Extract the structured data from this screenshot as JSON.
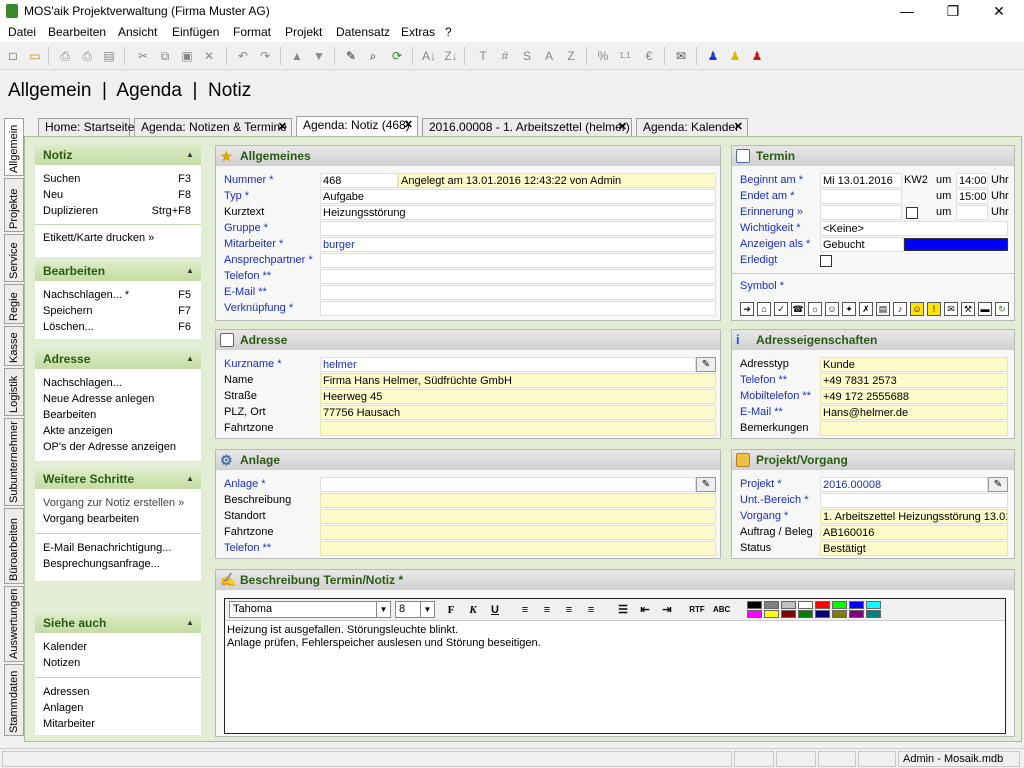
{
  "window": {
    "title": "MOS'aik Projektverwaltung (Firma Muster AG)",
    "min": "—",
    "max": "❐",
    "close": "✕"
  },
  "menu": [
    "Datei",
    "Bearbeiten",
    "Ansicht",
    "Einfügen",
    "Format",
    "Projekt",
    "Datensatz",
    "Extras",
    "?"
  ],
  "page_title": "Allgemein  |  Agenda  |  Notiz",
  "tabs": [
    {
      "label": "Home: Startseite",
      "closable": false
    },
    {
      "label": "Agenda: Notizen & Termine",
      "closable": true
    },
    {
      "label": "Agenda: Notiz (468)",
      "closable": true,
      "active": true
    },
    {
      "label": "2016.00008 - 1. Arbeitszettel (helmer)",
      "closable": true
    },
    {
      "label": "Agenda: Kalender",
      "closable": true
    }
  ],
  "vtabs": [
    "Allgemein",
    "Projekte",
    "Service",
    "Regie",
    "Kasse",
    "Logistik",
    "Subunternehmer",
    "Büroarbeiten",
    "Auswertungen",
    "Stammdaten"
  ],
  "sidebar": {
    "notiz": {
      "title": "Notiz",
      "items": [
        {
          "label": "Suchen",
          "key": "F3"
        },
        {
          "label": "Neu",
          "key": "F8"
        },
        {
          "label": "Duplizieren",
          "key": "Strg+F8"
        },
        {
          "label": "Etikett/Karte drucken »",
          "key": ""
        }
      ]
    },
    "bearbeiten": {
      "title": "Bearbeiten",
      "items": [
        {
          "label": "Nachschlagen... *",
          "key": "F5"
        },
        {
          "label": "Speichern",
          "key": "F7"
        },
        {
          "label": "Löschen...",
          "key": "F6"
        }
      ]
    },
    "adresse": {
      "title": "Adresse",
      "items": [
        {
          "label": "Nachschlagen..."
        },
        {
          "label": "Neue Adresse anlegen"
        },
        {
          "label": "Bearbeiten"
        },
        {
          "label": "Akte anzeigen"
        },
        {
          "label": "OP's der Adresse anzeigen"
        }
      ]
    },
    "weitere": {
      "title": "Weitere Schritte",
      "items": [
        {
          "label": "Vorgang zur Notiz erstellen »"
        },
        {
          "label": "Vorgang bearbeiten"
        },
        {
          "label": "E-Mail Benachrichtigung..."
        },
        {
          "label": "Besprechungsanfrage..."
        }
      ]
    },
    "siehe": {
      "title": "Siehe auch",
      "items": [
        {
          "label": "Kalender"
        },
        {
          "label": "Notizen"
        },
        {
          "label": "Adressen"
        },
        {
          "label": "Anlagen"
        },
        {
          "label": "Mitarbeiter"
        }
      ]
    }
  },
  "allgemeines": {
    "title": "Allgemeines",
    "labels": [
      "Nummer *",
      "Typ *",
      "Kurztext",
      "Gruppe *",
      "Mitarbeiter *",
      "Ansprechpartner *",
      "Telefon **",
      "E-Mail **",
      "Verknüpfung *"
    ],
    "nummer": "468",
    "angelegt": "Angelegt am 13.01.2016 12:43:22 von Admin",
    "typ": "Aufgabe",
    "kurztext": "Heizungsstörung",
    "mitarbeiter": "burger"
  },
  "termin": {
    "title": "Termin",
    "beginnt_label": "Beginnt am *",
    "beginnt_date": "Mi 13.01.2016",
    "kw": "KW2",
    "um1": "um",
    "time1": "14:00",
    "uhr1": "Uhr",
    "endet_label": "Endet am *",
    "um2": "um",
    "time2": "15:00",
    "uhr2": "Uhr",
    "erinnerung_label": "Erinnerung »",
    "um3": "um",
    "uhr3": "Uhr",
    "wichtigkeit_label": "Wichtigkeit *",
    "wichtigkeit": "<Keine>",
    "anzeigen_label": "Anzeigen als *",
    "anzeigen": "Gebucht",
    "anzeigen_color": "#0000ff",
    "erledigt_label": "Erledigt",
    "symbol_label": "Symbol *"
  },
  "adresse": {
    "title": "Adresse",
    "labels": [
      "Kurzname *",
      "Name",
      "Straße",
      "PLZ, Ort",
      "Fahrtzone"
    ],
    "kurzname": "helmer",
    "name": "Firma Hans Helmer, Südfrüchte GmbH",
    "strasse": "Heerweg 45",
    "plzort": "77756 Hausach"
  },
  "adresseigenschaften": {
    "title": "Adresseigenschaften",
    "labels": [
      "Adresstyp",
      "Telefon **",
      "Mobiltelefon **",
      "E-Mail **",
      "Bemerkungen"
    ],
    "adresstyp": "Kunde",
    "telefon": "+49 7831 2573",
    "mobil": "+49 172 2555688",
    "email": "Hans@helmer.de"
  },
  "anlage": {
    "title": "Anlage",
    "labels": [
      "Anlage *",
      "Beschreibung",
      "Standort",
      "Fahrtzone",
      "Telefon **"
    ]
  },
  "projekt": {
    "title": "Projekt/Vorgang",
    "labels": [
      "Projekt *",
      "Unt.-Bereich *",
      "Vorgang *",
      "Auftrag / Beleg",
      "Status"
    ],
    "projekt": "2016.00008",
    "vorgang": "1. Arbeitszettel Heizungsstörung 13.01",
    "auftrag": "AB160016",
    "status": "Bestätigt"
  },
  "beschreibung": {
    "title": "Beschreibung Termin/Notiz *",
    "font": "Tahoma",
    "size": "8",
    "line1": "Heizung ist ausgefallen. Störungsleuchte blinkt.",
    "line2": "Anlage prüfen, Fehlerspeicher auslesen und Störung beseitigen.",
    "palette": [
      "#000000",
      "#808080",
      "#c0c0c0",
      "#ffffff",
      "#ff0000",
      "#00ff00",
      "#0000ff",
      "#00ffff",
      "#ff00ff",
      "#ffff00",
      "#800000",
      "#008000",
      "#000080",
      "#808000",
      "#800080",
      "#008080"
    ]
  },
  "status": {
    "user": "Admin - Mosaik.mdb"
  }
}
